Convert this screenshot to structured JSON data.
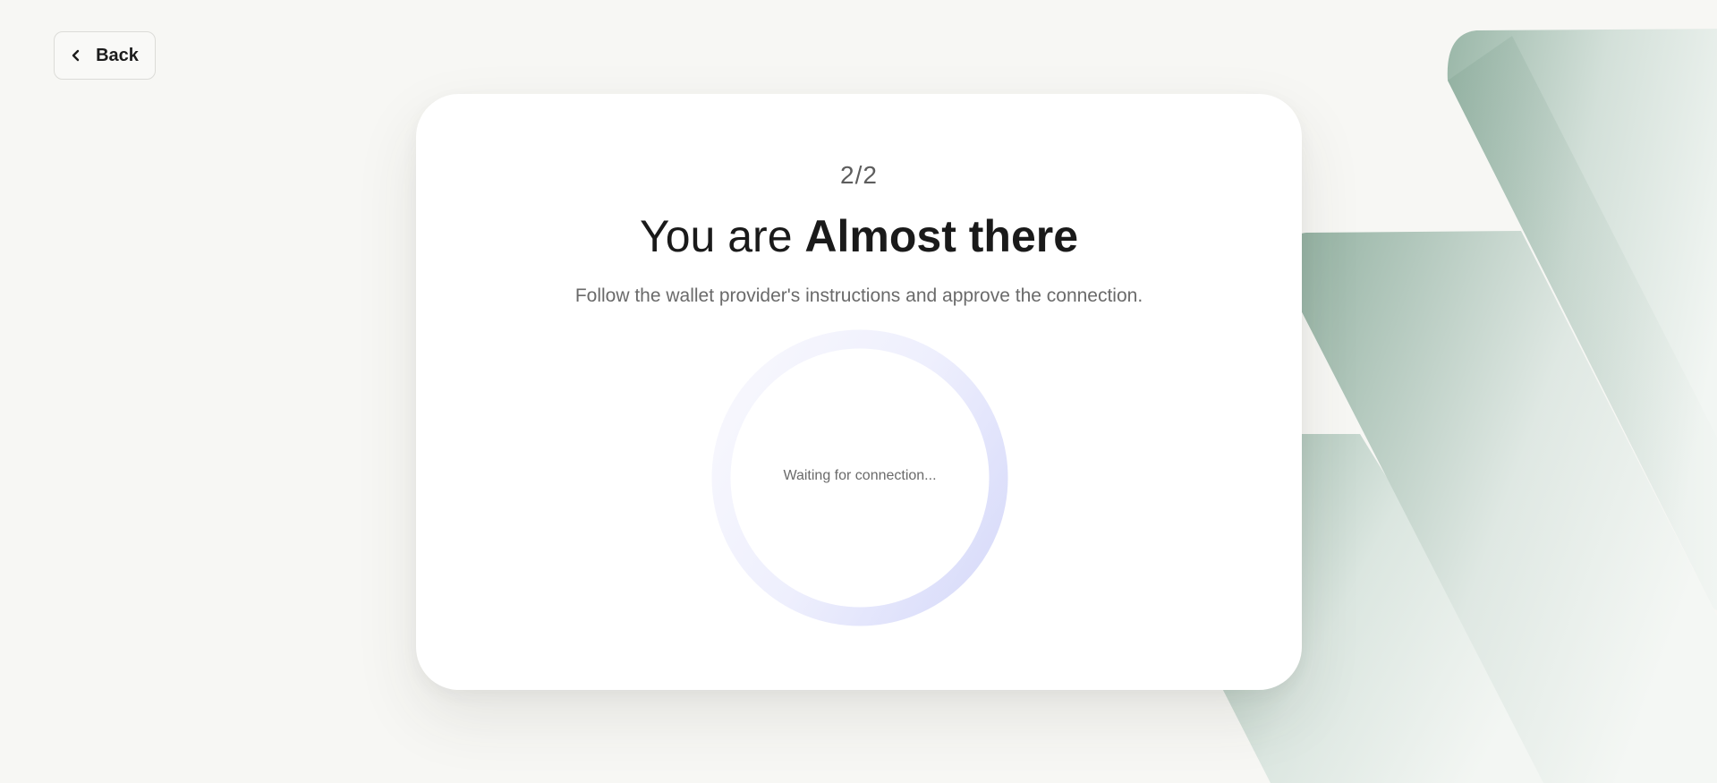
{
  "back": {
    "label": "Back"
  },
  "step": {
    "text": "2/2"
  },
  "title": {
    "light": "You are ",
    "bold": "Almost there"
  },
  "subtitle": "Follow the wallet provider's instructions and approve the connection.",
  "status": {
    "text": "Waiting for connection..."
  },
  "colors": {
    "page_background": "#f7f7f4",
    "card_background": "#ffffff",
    "ring_light": "#f4f5fd",
    "ring_dark": "#dcdffb",
    "decor_green": "#88a799"
  },
  "icons": {
    "back": "chevron-left-icon"
  }
}
